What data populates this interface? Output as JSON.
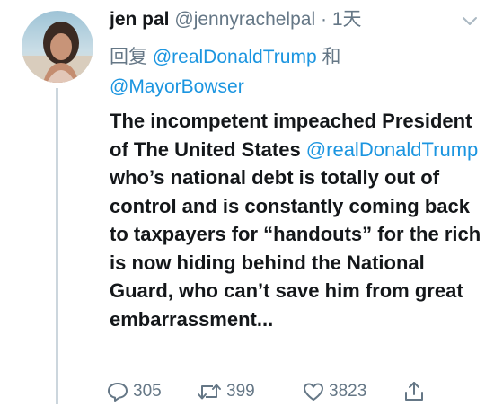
{
  "tweet": {
    "display_name": "jen pal",
    "handle": "@jennyrachelpal",
    "separator": "·",
    "time": "1天",
    "reply_prefix": "回复",
    "reply_to_1": "@realDonaldTrump",
    "reply_conj": "和",
    "reply_to_2": "@MayorBowser",
    "text_part1": "The incompetent impeached President of The United States ",
    "text_mention": "@realDonaldTrump",
    "text_part2": " who’s national debt is totally out of control and is constantly coming back to taxpayers for “handouts” for the rich is now hiding behind the National Guard, who can’t save him from great embarrassment...",
    "reply_count": "305",
    "retweet_count": "399",
    "like_count": "3823"
  },
  "icons": {
    "reply": "reply-icon",
    "retweet": "retweet-icon",
    "like": "heart-icon",
    "share": "share-icon",
    "more": "chevron-down-icon"
  },
  "colors": {
    "link": "#1b95e0",
    "muted": "#657786",
    "text": "#14171a",
    "thread_line": "#ccd6dd"
  }
}
